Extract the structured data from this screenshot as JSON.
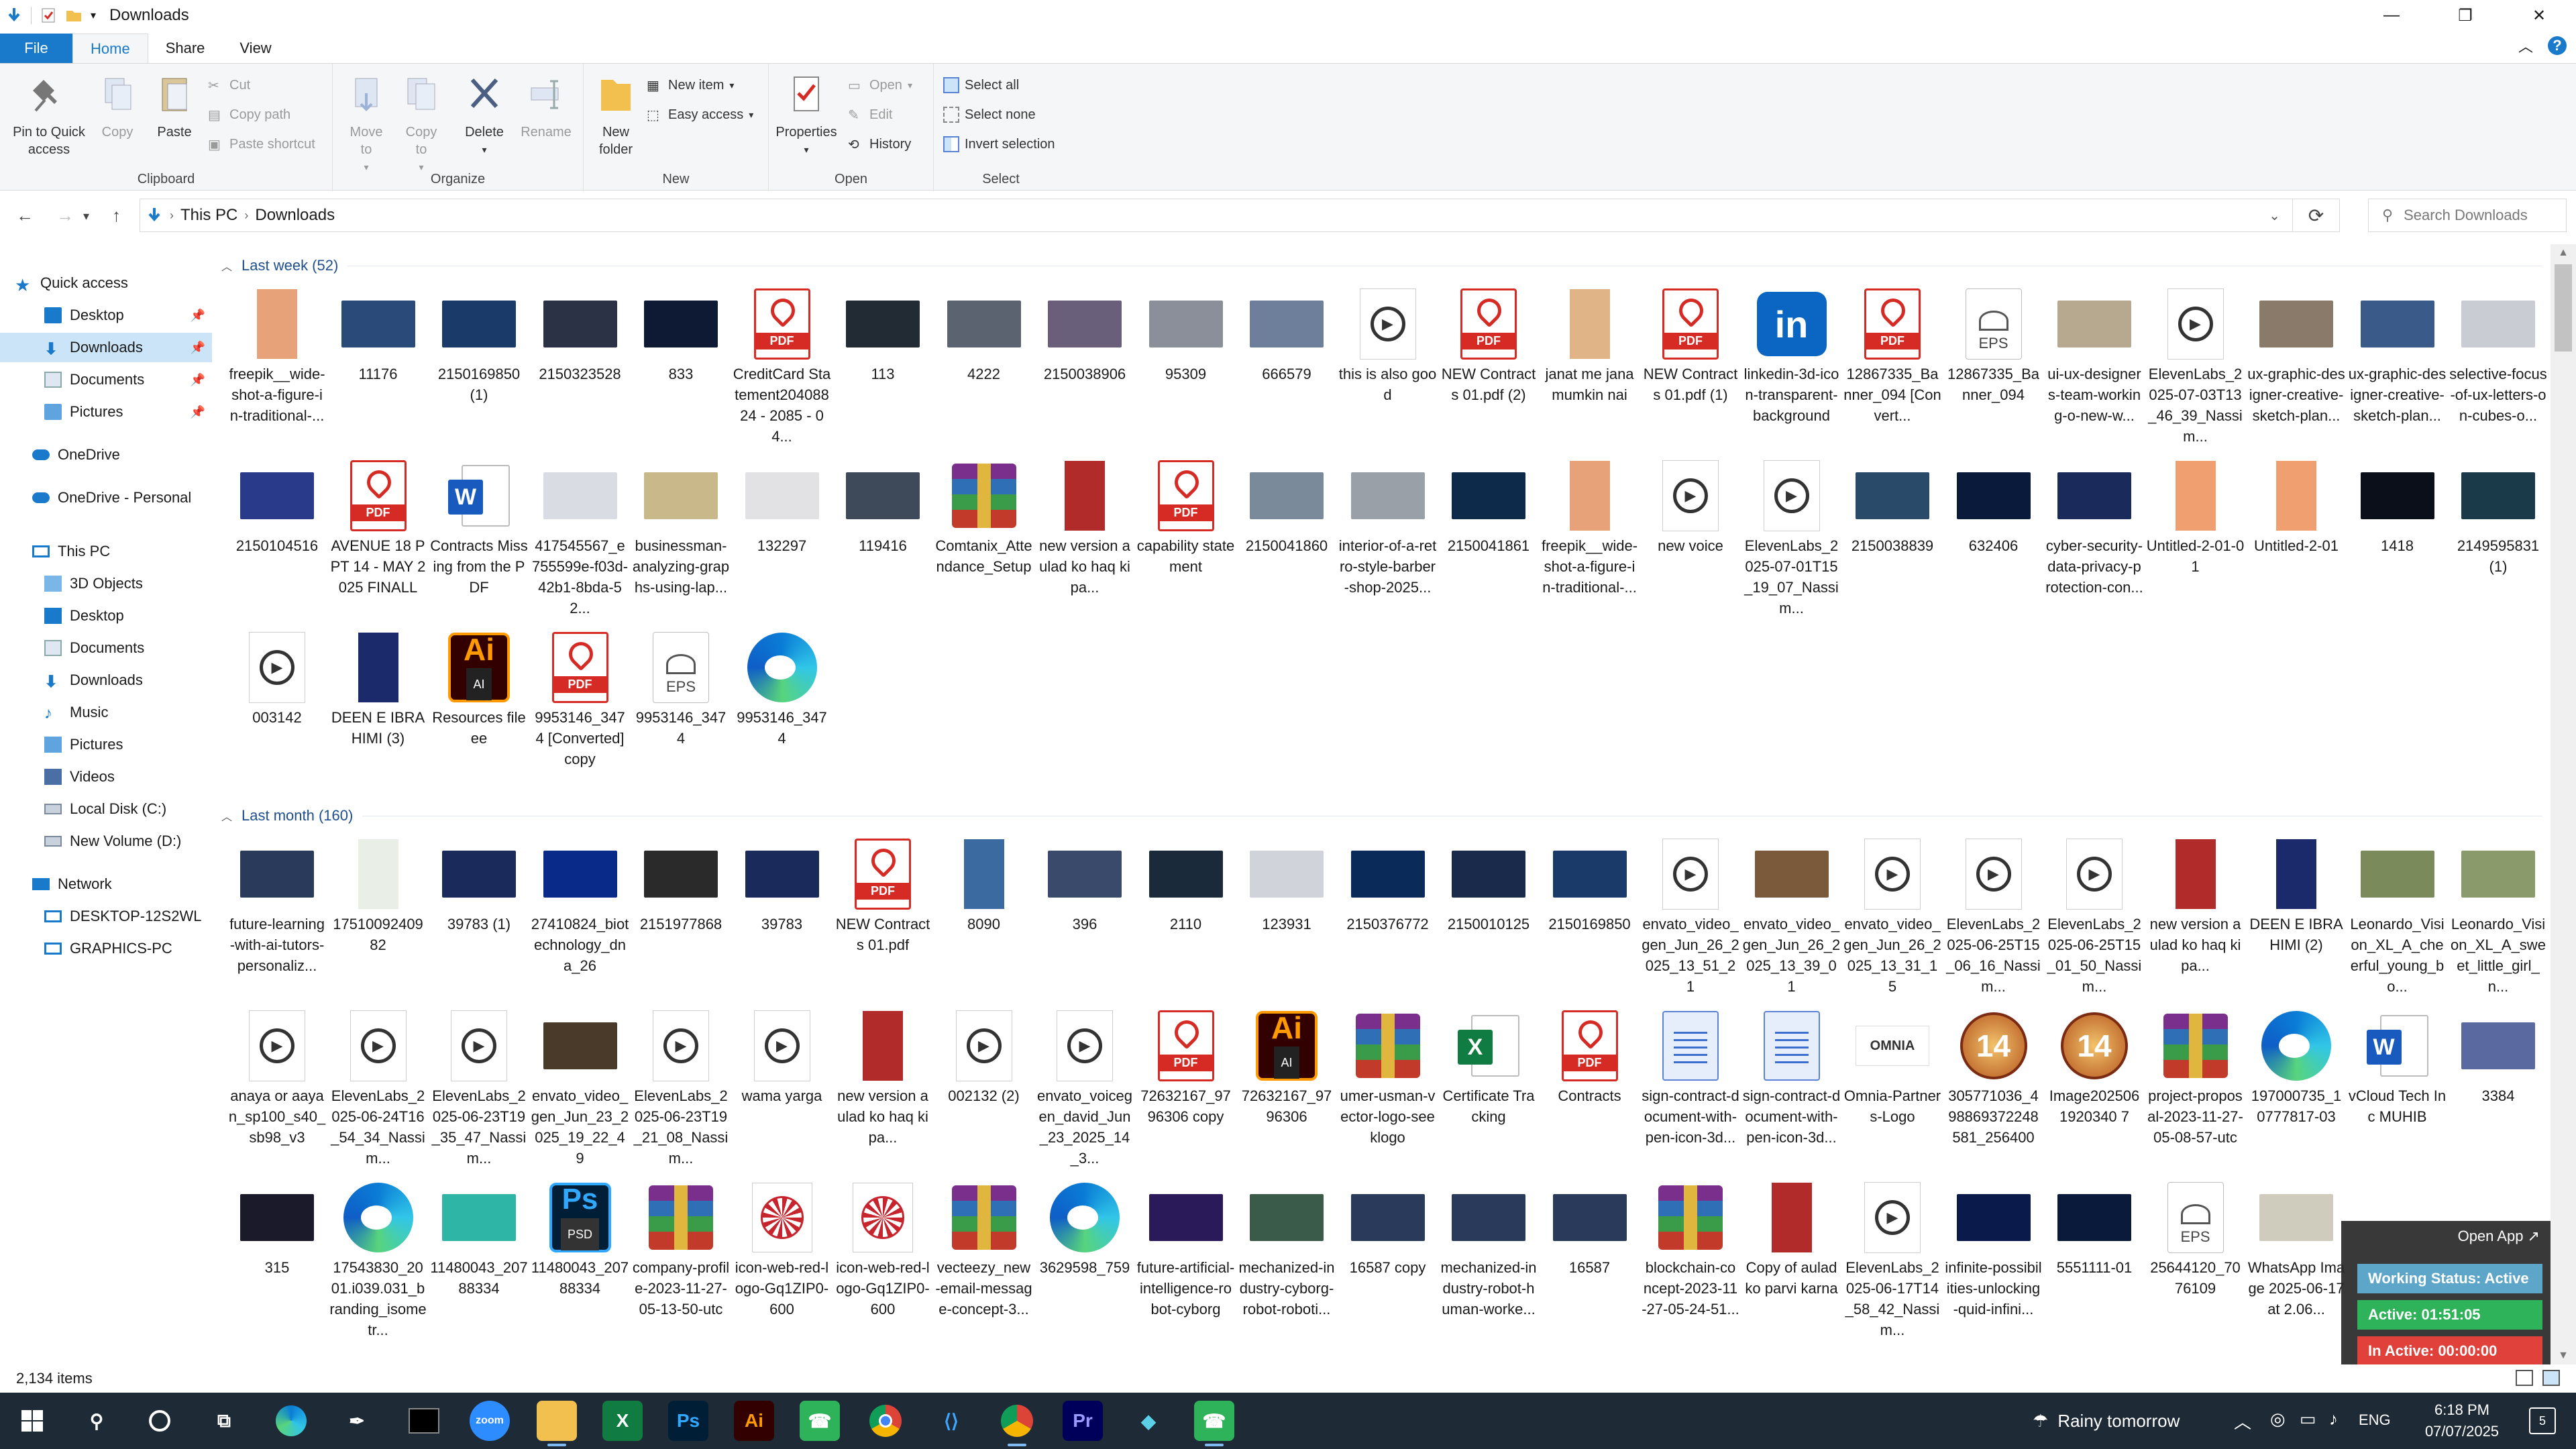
{
  "window": {
    "title": "Downloads"
  },
  "ribbon_tabs": [
    "File",
    "Home",
    "Share",
    "View"
  ],
  "ribbon": {
    "clipboard": {
      "label": "Clipboard",
      "pin": "Pin to Quick access",
      "copy": "Copy",
      "paste": "Paste",
      "cut": "Cut",
      "copy_path": "Copy path",
      "paste_shortcut": "Paste shortcut"
    },
    "organize": {
      "label": "Organize",
      "move_to": "Move to",
      "copy_to": "Copy to",
      "delete": "Delete",
      "rename": "Rename"
    },
    "new": {
      "label": "New",
      "new_folder": "New folder",
      "new_item": "New item",
      "easy_access": "Easy access"
    },
    "open": {
      "label": "Open",
      "properties": "Properties",
      "open": "Open",
      "edit": "Edit",
      "history": "History"
    },
    "select": {
      "label": "Select",
      "select_all": "Select all",
      "select_none": "Select none",
      "invert": "Invert selection"
    }
  },
  "address": {
    "crumbs": [
      "This PC",
      "Downloads"
    ],
    "search_placeholder": "Search Downloads"
  },
  "navpane": {
    "quick_access": "Quick access",
    "quick_items": [
      "Desktop",
      "Downloads",
      "Documents",
      "Pictures"
    ],
    "onedrive": "OneDrive",
    "onedrive_personal": "OneDrive - Personal",
    "this_pc": "This PC",
    "pc_items": [
      "3D Objects",
      "Desktop",
      "Documents",
      "Downloads",
      "Music",
      "Pictures",
      "Videos",
      "Local Disk (C:)",
      "New Volume (D:)"
    ],
    "network": "Network",
    "network_items": [
      "DESKTOP-12S2WL",
      "GRAPHICS-PC"
    ]
  },
  "groups": {
    "last_week": "Last week (52)",
    "last_month": "Last month (160)"
  },
  "files_week": [
    {
      "name": "freepik__wide-shot-a-figure-in-traditional-...",
      "type": "imgtall",
      "color": "#e8a27a"
    },
    {
      "name": "11176",
      "type": "img",
      "color": "#2a4a7a"
    },
    {
      "name": "2150169850 (1)",
      "type": "img",
      "color": "#1a3a6a"
    },
    {
      "name": "2150323528",
      "type": "img",
      "color": "#2b3245"
    },
    {
      "name": "833",
      "type": "img",
      "color": "#0e1a33"
    },
    {
      "name": "CreditCard Statement20408824 - 2085 - 04...",
      "type": "pdf"
    },
    {
      "name": "113",
      "type": "img",
      "color": "#222a33"
    },
    {
      "name": "4222",
      "type": "img",
      "color": "#5b6270"
    },
    {
      "name": "2150038906",
      "type": "img",
      "color": "#6a5f7a"
    },
    {
      "name": "95309",
      "type": "img",
      "color": "#8a8f9a"
    },
    {
      "name": "666579",
      "type": "img",
      "color": "#6d7f9a"
    },
    {
      "name": "this is also good",
      "type": "video"
    },
    {
      "name": "NEW Contracts 01.pdf (2)",
      "type": "pdf"
    },
    {
      "name": "janat me jana mumkin nai",
      "type": "imgtall",
      "color": "#e0b487"
    },
    {
      "name": "NEW Contracts 01.pdf (1)",
      "type": "pdf"
    },
    {
      "name": "linkedin-3d-icon-transparent-background",
      "type": "linkedin"
    },
    {
      "name": "12867335_Banner_094 [Convert...",
      "type": "pdf"
    },
    {
      "name": "12867335_Banner_094",
      "type": "eps"
    },
    {
      "name": "ui-ux-designers-team-working-o-new-w...",
      "type": "img",
      "color": "#b7a890"
    },
    {
      "name": "ElevenLabs_2025-07-03T13_46_39_Nassim...",
      "type": "video"
    },
    {
      "name": "ux-graphic-designer-creative-sketch-plan...",
      "type": "img",
      "color": "#8a7a6a"
    },
    {
      "name": "ux-graphic-designer-creative-sketch-plan...",
      "type": "img",
      "color": "#3a5a8a"
    },
    {
      "name": "selective-focus-of-ux-letters-on-cubes-o...",
      "type": "img",
      "color": "#c9ccd2"
    },
    {
      "name": "2150104516",
      "type": "img",
      "color": "#2a3a8a"
    },
    {
      "name": "AVENUE 18 PPT 14 - MAY 2025 FINALL",
      "type": "pdf"
    },
    {
      "name": "Contracts Missing from the PDF",
      "type": "word"
    },
    {
      "name": "417545567_e755599e-f03d-42b1-8bda-52...",
      "type": "img",
      "color": "#d9dde3"
    },
    {
      "name": "businessman-analyzing-graphs-using-lap...",
      "type": "img",
      "color": "#c9b98a"
    },
    {
      "name": "132297",
      "type": "img",
      "color": "#e2e2e4"
    },
    {
      "name": "119416",
      "type": "img",
      "color": "#3e4a5a"
    },
    {
      "name": "Comtanix_Attendance_Setup",
      "type": "rar"
    },
    {
      "name": "new version aulad ko haq ki pa...",
      "type": "imgtall",
      "color": "#b12b2b"
    },
    {
      "name": "capability statement",
      "type": "pdf"
    },
    {
      "name": "2150041860",
      "type": "img",
      "color": "#7a8a9a"
    },
    {
      "name": "interior-of-a-retro-style-barber-shop-2025...",
      "type": "img",
      "color": "#9aa0a8"
    },
    {
      "name": "2150041861",
      "type": "img",
      "color": "#0e2a4a"
    },
    {
      "name": "freepik__wide-shot-a-figure-in-traditional-...",
      "type": "imgtall",
      "color": "#e8a27a"
    },
    {
      "name": "new voice",
      "type": "video"
    },
    {
      "name": "ElevenLabs_2025-07-01T15_19_07_Nassim...",
      "type": "video"
    },
    {
      "name": "2150038839",
      "type": "img",
      "color": "#2a4a6a"
    },
    {
      "name": "632406",
      "type": "img",
      "color": "#0a1a3a"
    },
    {
      "name": "cyber-security-data-privacy-protection-con...",
      "type": "img",
      "color": "#1a2a5a"
    },
    {
      "name": "Untitled-2-01-01",
      "type": "imgtall",
      "color": "#f0a070"
    },
    {
      "name": "Untitled-2-01",
      "type": "imgtall",
      "color": "#f0a070"
    },
    {
      "name": "1418",
      "type": "img",
      "color": "#0a0f1a"
    },
    {
      "name": "2149595831 (1)",
      "type": "img",
      "color": "#1a3a4a"
    },
    {
      "name": "003142",
      "type": "video"
    },
    {
      "name": "DEEN E IBRAHIMI (3)",
      "type": "imgtall",
      "color": "#1a2a6a"
    },
    {
      "name": "Resources fileee",
      "type": "ai"
    },
    {
      "name": "9953146_3474 [Converted] copy",
      "type": "pdf"
    },
    {
      "name": "9953146_3474",
      "type": "eps"
    },
    {
      "name": "9953146_3474",
      "type": "edge"
    }
  ],
  "files_month": [
    {
      "name": "future-learning-with-ai-tutors-personaliz...",
      "type": "img",
      "color": "#2a3a5a"
    },
    {
      "name": "1751009240982",
      "type": "imgtall",
      "color": "#e9efe6"
    },
    {
      "name": "39783 (1)",
      "type": "img",
      "color": "#1a2a5a"
    },
    {
      "name": "27410824_biotechnology_dna_26",
      "type": "img",
      "color": "#0a2a8a"
    },
    {
      "name": "2151977868",
      "type": "img",
      "color": "#2a2a2a"
    },
    {
      "name": "39783",
      "type": "img",
      "color": "#1a2a5a"
    },
    {
      "name": "NEW Contracts 01.pdf",
      "type": "pdf"
    },
    {
      "name": "8090",
      "type": "imgtall",
      "color": "#3a6aa0"
    },
    {
      "name": "396",
      "type": "img",
      "color": "#3a4a6a"
    },
    {
      "name": "2110",
      "type": "img",
      "color": "#1a2a3a"
    },
    {
      "name": "123931",
      "type": "img",
      "color": "#d0d4da"
    },
    {
      "name": "2150376772",
      "type": "img",
      "color": "#0a2a5a"
    },
    {
      "name": "2150010125",
      "type": "img",
      "color": "#1a2a4a"
    },
    {
      "name": "2150169850",
      "type": "img",
      "color": "#1a3a6a"
    },
    {
      "name": "envato_video_gen_Jun_26_2025_13_51_21",
      "type": "video"
    },
    {
      "name": "envato_video_gen_Jun_26_2025_13_39_01",
      "type": "img",
      "color": "#7a5a3a"
    },
    {
      "name": "envato_video_gen_Jun_26_2025_13_31_15",
      "type": "video"
    },
    {
      "name": "ElevenLabs_2025-06-25T15_06_16_Nassim...",
      "type": "video"
    },
    {
      "name": "ElevenLabs_2025-06-25T15_01_50_Nassim...",
      "type": "video"
    },
    {
      "name": "new version aulad ko haq ki pa...",
      "type": "imgtall",
      "color": "#b12b2b"
    },
    {
      "name": "DEEN E IBRAHIMI (2)",
      "type": "imgtall",
      "color": "#1a2a6a"
    },
    {
      "name": "Leonardo_Vision_XL_A_cheerful_young_bo...",
      "type": "img",
      "color": "#7a8a5a"
    },
    {
      "name": "Leonardo_Vision_XL_A_sweet_little_girl_n...",
      "type": "img",
      "color": "#8a9a6a"
    },
    {
      "name": "anaya or aayan_sp100_s40_sb98_v3",
      "type": "video"
    },
    {
      "name": "ElevenLabs_2025-06-24T16_54_34_Nassim...",
      "type": "video"
    },
    {
      "name": "ElevenLabs_2025-06-23T19_35_47_Nassim...",
      "type": "video"
    },
    {
      "name": "envato_video_gen_Jun_23_2025_19_22_49",
      "type": "img",
      "color": "#4a3a2a"
    },
    {
      "name": "ElevenLabs_2025-06-23T19_21_08_Nassim...",
      "type": "video"
    },
    {
      "name": "wama yarga",
      "type": "video"
    },
    {
      "name": "new version aulad ko haq ki pa...",
      "type": "imgtall",
      "color": "#b12b2b"
    },
    {
      "name": "002132 (2)",
      "type": "video"
    },
    {
      "name": "envato_voicegen_david_Jun_23_2025_14_3...",
      "type": "video"
    },
    {
      "name": "72632167_9796306 copy",
      "type": "pdf"
    },
    {
      "name": "72632167_9796306",
      "type": "ai"
    },
    {
      "name": "umer-usman-vector-logo-seeklogo",
      "type": "rar"
    },
    {
      "name": "Certificate Tracking",
      "type": "excel"
    },
    {
      "name": "Contracts",
      "type": "pdf"
    },
    {
      "name": "sign-contract-document-with-pen-icon-3d...",
      "type": "docblue"
    },
    {
      "name": "sign-contract-document-with-pen-icon-3d...",
      "type": "docblue"
    },
    {
      "name": "Omnia-Partners-Logo",
      "type": "omnia"
    },
    {
      "name": "305771036_498869372248581_256400",
      "type": "badge14"
    },
    {
      "name": "Image2025061920340 7",
      "type": "badge14"
    },
    {
      "name": "project-proposal-2023-11-27-05-08-57-utc",
      "type": "rar"
    },
    {
      "name": "197000735_10777817-03",
      "type": "edge"
    },
    {
      "name": "vCloud Tech Inc MUHIB",
      "type": "word"
    },
    {
      "name": "3384",
      "type": "img",
      "color": "#5a6aa0"
    },
    {
      "name": "315",
      "type": "img",
      "color": "#1a1a2a"
    },
    {
      "name": "17543830_2001.i039.031_branding_isometr...",
      "type": "edge"
    },
    {
      "name": "11480043_20788334",
      "type": "img",
      "color": "#2fb5a5"
    },
    {
      "name": "11480043_20788334",
      "type": "ps"
    },
    {
      "name": "company-profile-2023-11-27-05-13-50-utc",
      "type": "rar"
    },
    {
      "name": "icon-web-red-logo-Gq1ZIP0-600",
      "type": "web"
    },
    {
      "name": "icon-web-red-logo-Gq1ZIP0-600",
      "type": "web"
    },
    {
      "name": "vecteezy_new-email-message-concept-3...",
      "type": "rar"
    },
    {
      "name": "3629598_759",
      "type": "edge"
    },
    {
      "name": "future-artificial-intelligence-robot-cyborg",
      "type": "img",
      "color": "#2a1a5a"
    },
    {
      "name": "mechanized-industry-cyborg-robot-roboti...",
      "type": "img",
      "color": "#3a5a4a"
    },
    {
      "name": "16587 copy",
      "type": "img",
      "color": "#2a3a5a"
    },
    {
      "name": "mechanized-industry-robot-human-worke...",
      "type": "img",
      "color": "#2a3a5a"
    },
    {
      "name": "16587",
      "type": "img",
      "color": "#2a3a5a"
    },
    {
      "name": "blockchain-concept-2023-11-27-05-24-51...",
      "type": "rar"
    },
    {
      "name": "Copy of aulad ko parvi karna",
      "type": "imgtall",
      "color": "#b12b2b"
    },
    {
      "name": "ElevenLabs_2025-06-17T14_58_42_Nassim...",
      "type": "video"
    },
    {
      "name": "infinite-possibilities-unlocking-quid-infini...",
      "type": "img",
      "color": "#0a1a4a"
    },
    {
      "name": "5551111-01",
      "type": "img",
      "color": "#0a1a3a"
    },
    {
      "name": "25644120_7076109",
      "type": "eps"
    },
    {
      "name": "WhatsApp Image 2025-06-17 at 2.06...",
      "type": "img",
      "color": "#cfcbbd"
    }
  ],
  "status": {
    "count": "2,134 items"
  },
  "overlay": {
    "open_app": "Open App ↗",
    "status": "Working Status: Active",
    "active": "Active: 01:51:05",
    "inactive": "In Active: 00:00:00"
  },
  "taskbar": {
    "weather": "Rainy tomorrow",
    "lang": "ENG",
    "time": "6:18 PM",
    "date": "07/07/2025",
    "notif": "5"
  },
  "colors": {
    "accent": "#1979ca",
    "selection": "#cce4f7",
    "group_header": "#1e4e8c",
    "taskbar": "#1f2a37"
  }
}
